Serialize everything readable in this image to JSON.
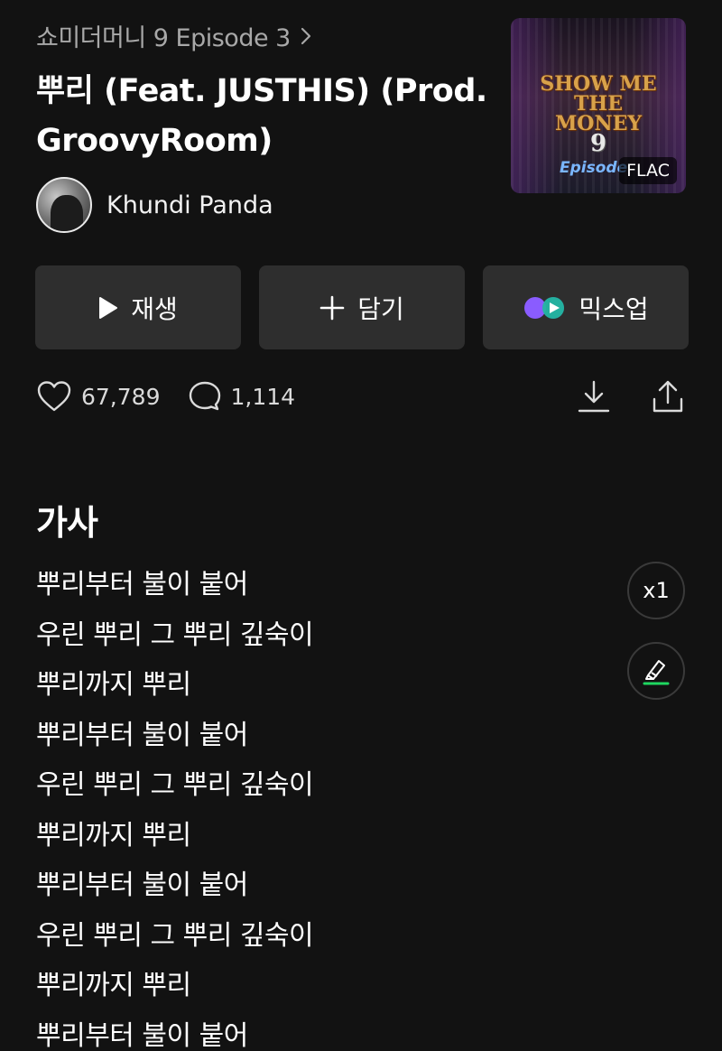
{
  "album": {
    "title": "쇼미더머니 9 Episode 3"
  },
  "song": {
    "title": "뿌리 (Feat. JUSTHIS) (Prod. GroovyRoom)"
  },
  "artist": {
    "name": "Khundi Panda"
  },
  "cover": {
    "format_badge": "FLAC",
    "logo_line1": "SHOW ME",
    "logo_line2": "THE MONEY",
    "logo_number": "9",
    "episode_text": "Episode"
  },
  "actions": {
    "play_label": "재생",
    "add_label": "담기",
    "mixup_label": "믹스업"
  },
  "stats": {
    "likes": "67,789",
    "comments": "1,114"
  },
  "lyrics": {
    "heading": "가사",
    "speed_label": "x1",
    "lines": [
      "뿌리부터 불이 붙어",
      "우린 뿌리 그 뿌리 깊숙이",
      "뿌리까지 뿌리",
      "뿌리부터 불이 붙어",
      "우린 뿌리 그 뿌리 깊숙이",
      "뿌리까지 뿌리",
      "뿌리부터 불이 붙어",
      "우린 뿌리 그 뿌리 깊숙이",
      "뿌리까지 뿌리",
      "뿌리부터 불이 붙어"
    ]
  },
  "colors": {
    "background": "#121212",
    "button_bg": "#2e2e2e",
    "muted_text": "#a8a8a8",
    "highlight_green": "#1ed760",
    "mixup_purple": "#8a5cff",
    "mixup_blue": "#2f8bff"
  }
}
